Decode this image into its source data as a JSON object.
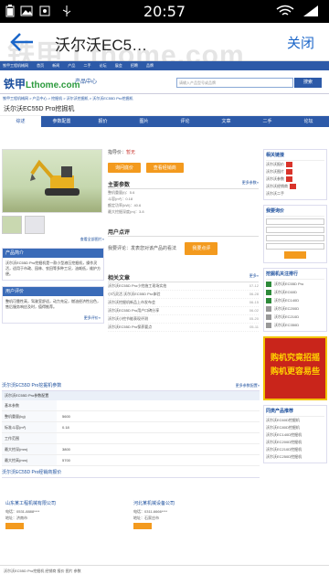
{
  "statusbar": {
    "time": "20:57"
  },
  "titlebar": {
    "title": "沃尔沃EC5…",
    "close_label": "关闭",
    "watermark": "铁甲 Lthome.com"
  },
  "web": {
    "topnav": [
      "铁甲工程机械网",
      "首页",
      "新闻",
      "产品",
      "二手",
      "论坛",
      "展会",
      "招聘",
      "品牌"
    ],
    "logo_main": "铁甲",
    "logo_sub": "Lthome.com",
    "subtitle": "产品中心",
    "search_placeholder": "请输入产品型号或品牌",
    "search_button": "搜索",
    "breadcrumb": "铁甲工程机械网 > 产品中心 > 挖掘机 > 沃尔沃挖掘机 > 沃尔沃EC55D Pro挖掘机",
    "product_title": "沃尔沃EC55D Pro挖掘机",
    "tabs": [
      "综述",
      "参数配置",
      "报价",
      "图片",
      "评论",
      "文章",
      "二手",
      "论坛"
    ],
    "main_fields": {
      "price_label": "指导价：",
      "price_value": "暂无"
    },
    "buttons": {
      "ask_price": "询问底价",
      "dealer": "查看经销商"
    },
    "section_specs": "主要参数",
    "specs_more": "更多参数»",
    "specs": [
      "整机重量(t)：5.6",
      "斗容(m³)：0.18",
      "额定功率(kW)：40.6",
      "最大挖掘深度(m)：3.8"
    ],
    "section_msg": "用户点评",
    "msg_text": "我要评论：发表您对该产品的看法",
    "msg_button": "我要点评",
    "section_news": "相关文章",
    "news_more": "更多»",
    "news": [
      {
        "t": "沃尔沃EC55D Pro小挖施工现场实拍",
        "d": "07-12"
      },
      {
        "t": "小巧灵活 沃尔沃EC55D Pro体验",
        "d": "06-28"
      },
      {
        "t": "沃尔沃挖掘机新品上市发布会",
        "d": "06-15"
      },
      {
        "t": "沃尔沃EC55D Pro用户口碑分享",
        "d": "06-02"
      },
      {
        "t": "沃尔沃小挖节能表现评测",
        "d": "05-20"
      },
      {
        "t": "沃尔沃EC55D Pro保养要点",
        "d": "05-11"
      }
    ],
    "thumb_link": "查看全部图片»",
    "panel1_title": "产品简介",
    "panel1_text": "沃尔沃EC55D Pro挖掘机是一款小型液压挖掘机，操作灵活，适用于市政、园林、农田等多种工况，油耗低，维护方便。",
    "panel2_title": "用户评价",
    "panel2_text": "整机可靠性高，驾驶室舒适，动力充足，燃油经济性出色，售后服务响应及时，值得推荐。",
    "panel2_more": "更多评价»",
    "right": {
      "box1_title": "相关链接",
      "box1_lines": [
        "沃尔沃报价",
        "沃尔沃图片",
        "沃尔沃参数",
        "沃尔沃经销商",
        "沃尔沃二手"
      ],
      "box2_title": "我要询价",
      "box3_title": "挖掘机关注排行",
      "rank": [
        "沃尔沃EC55D Pro",
        "沃尔沃EC60D",
        "沃尔沃EC140D",
        "沃尔沃EC200D",
        "沃尔沃EC210D",
        "沃尔沃EC350D"
      ],
      "ad_text": [
        "购机究竟招摇",
        "购机更容易些"
      ],
      "box4_title": "同类产品推荐",
      "box4_lines": [
        "沃尔沃EC60D挖掘机",
        "沃尔沃EC80D挖掘机",
        "沃尔沃EC140D挖掘机",
        "沃尔沃EC200D挖掘机",
        "沃尔沃EC210D挖掘机",
        "沃尔沃EC250D挖掘机"
      ]
    },
    "table": {
      "title": "沃尔沃EC55D Pro挖掘机参数",
      "more": "更多参数配置»",
      "subtab": "沃尔沃EC55D Pro参数配置",
      "rows": [
        {
          "k": "基本参数",
          "v": ""
        },
        {
          "k": "整机重量(kg)",
          "v": "5600"
        },
        {
          "k": "标准斗容(m³)",
          "v": "0.18"
        },
        {
          "k": "工作范围",
          "v": ""
        },
        {
          "k": "最大挖深(mm)",
          "v": "3800"
        },
        {
          "k": "最大挖高(mm)",
          "v": "5700"
        }
      ],
      "dealer_title": "沃尔沃EC55D Pro经销商报价"
    },
    "dealers": [
      {
        "name": "山东某工程机械有限公司",
        "phone": "电话：0531-8888****",
        "addr": "地址：济南市"
      },
      {
        "name": "河北某机械设备公司",
        "phone": "电话：0311-6666****",
        "addr": "地址：石家庄市"
      }
    ],
    "bottom": "沃尔沃EC55D Pro挖掘机 经销商 报价 图片 参数"
  }
}
